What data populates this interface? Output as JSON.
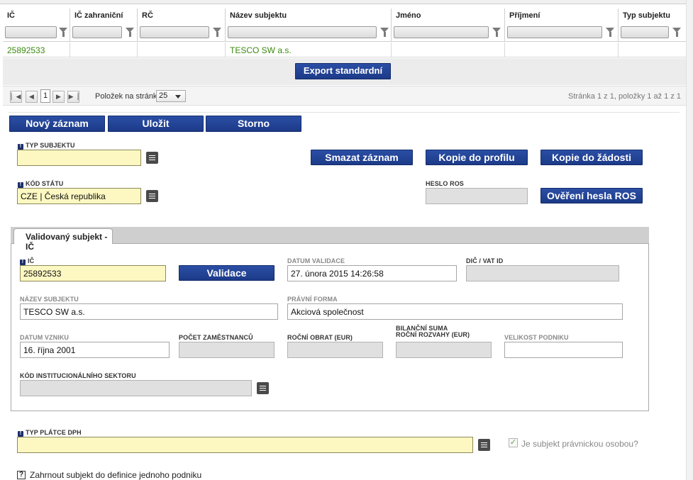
{
  "grid": {
    "columns": [
      {
        "label": "IČ"
      },
      {
        "label": "IČ zahraniční"
      },
      {
        "label": "RČ"
      },
      {
        "label": "Název subjektu"
      },
      {
        "label": "Jméno"
      },
      {
        "label": "Příjmení"
      },
      {
        "label": "Typ subjektu"
      }
    ],
    "row": [
      "25892533",
      "",
      "",
      "TESCO SW a.s.",
      "",
      "",
      ""
    ]
  },
  "export": {
    "label": "Export standardní"
  },
  "pager": {
    "current_page": "1",
    "per_page_label": "Položek na stránku",
    "per_page_value": "25",
    "info": "Stránka 1 z 1, položky 1 až 1 z 1"
  },
  "toolbar": {
    "new_label": "Nový záznam",
    "save_label": "Uložit",
    "cancel_label": "Storno"
  },
  "actions": {
    "delete_label": "Smazat záznam",
    "copy_profile_label": "Kopie do profilu",
    "copy_request_label": "Kopie do žádosti",
    "verify_ros_label": "Ověření hesla ROS"
  },
  "form": {
    "typ_subjektu": {
      "label": "TYP SUBJEKTU",
      "value": ""
    },
    "kod_statu": {
      "label": "KÓD STÁTU",
      "value": "CZE | Česká republika"
    },
    "heslo_ros": {
      "label": "HESLO ROS",
      "value": ""
    }
  },
  "tab": {
    "label": "Validovaný subjekt - IČ",
    "ic": {
      "label": "IČ",
      "value": "25892533"
    },
    "validate_label": "Validace",
    "datum_validace": {
      "label": "DATUM VALIDACE",
      "value": "27. února 2015 14:26:58"
    },
    "dic": {
      "label": "DIČ / VAT ID",
      "value": ""
    },
    "nazev": {
      "label": "NÁZEV SUBJEKTU",
      "value": "TESCO SW a.s."
    },
    "pravni_forma": {
      "label": "PRÁVNÍ FORMA",
      "value": "Akciová společnost"
    },
    "datum_vzniku": {
      "label": "DATUM VZNIKU",
      "value": "16. října 2001"
    },
    "pocet_zamestnancu": {
      "label": "POČET ZAMĚSTNANCŮ",
      "value": ""
    },
    "rocni_obrat": {
      "label": "ROČNÍ OBRAT (EUR)",
      "value": ""
    },
    "bilancni_suma_1": "BILANČNÍ SUMA",
    "bilancni_suma_2": "ROČNÍ ROZVAHY (EUR)",
    "bilancni_suma_value": "",
    "velikost_podniku": {
      "label": "VELIKOST PODNIKU",
      "value": ""
    },
    "kod_sektoru": {
      "label": "KÓD INSTITUCIONÁLNÍHO SEKTORU",
      "value": ""
    }
  },
  "typ_platce": {
    "label": "TYP PLÁTCE DPH",
    "value": ""
  },
  "pravnicka_osoba": {
    "label": "Je subjekt právnickou osobou?",
    "checked": true
  },
  "zahrnout": {
    "help": "?",
    "label": "Zahrnout subjekt do definice jednoho podniku"
  }
}
